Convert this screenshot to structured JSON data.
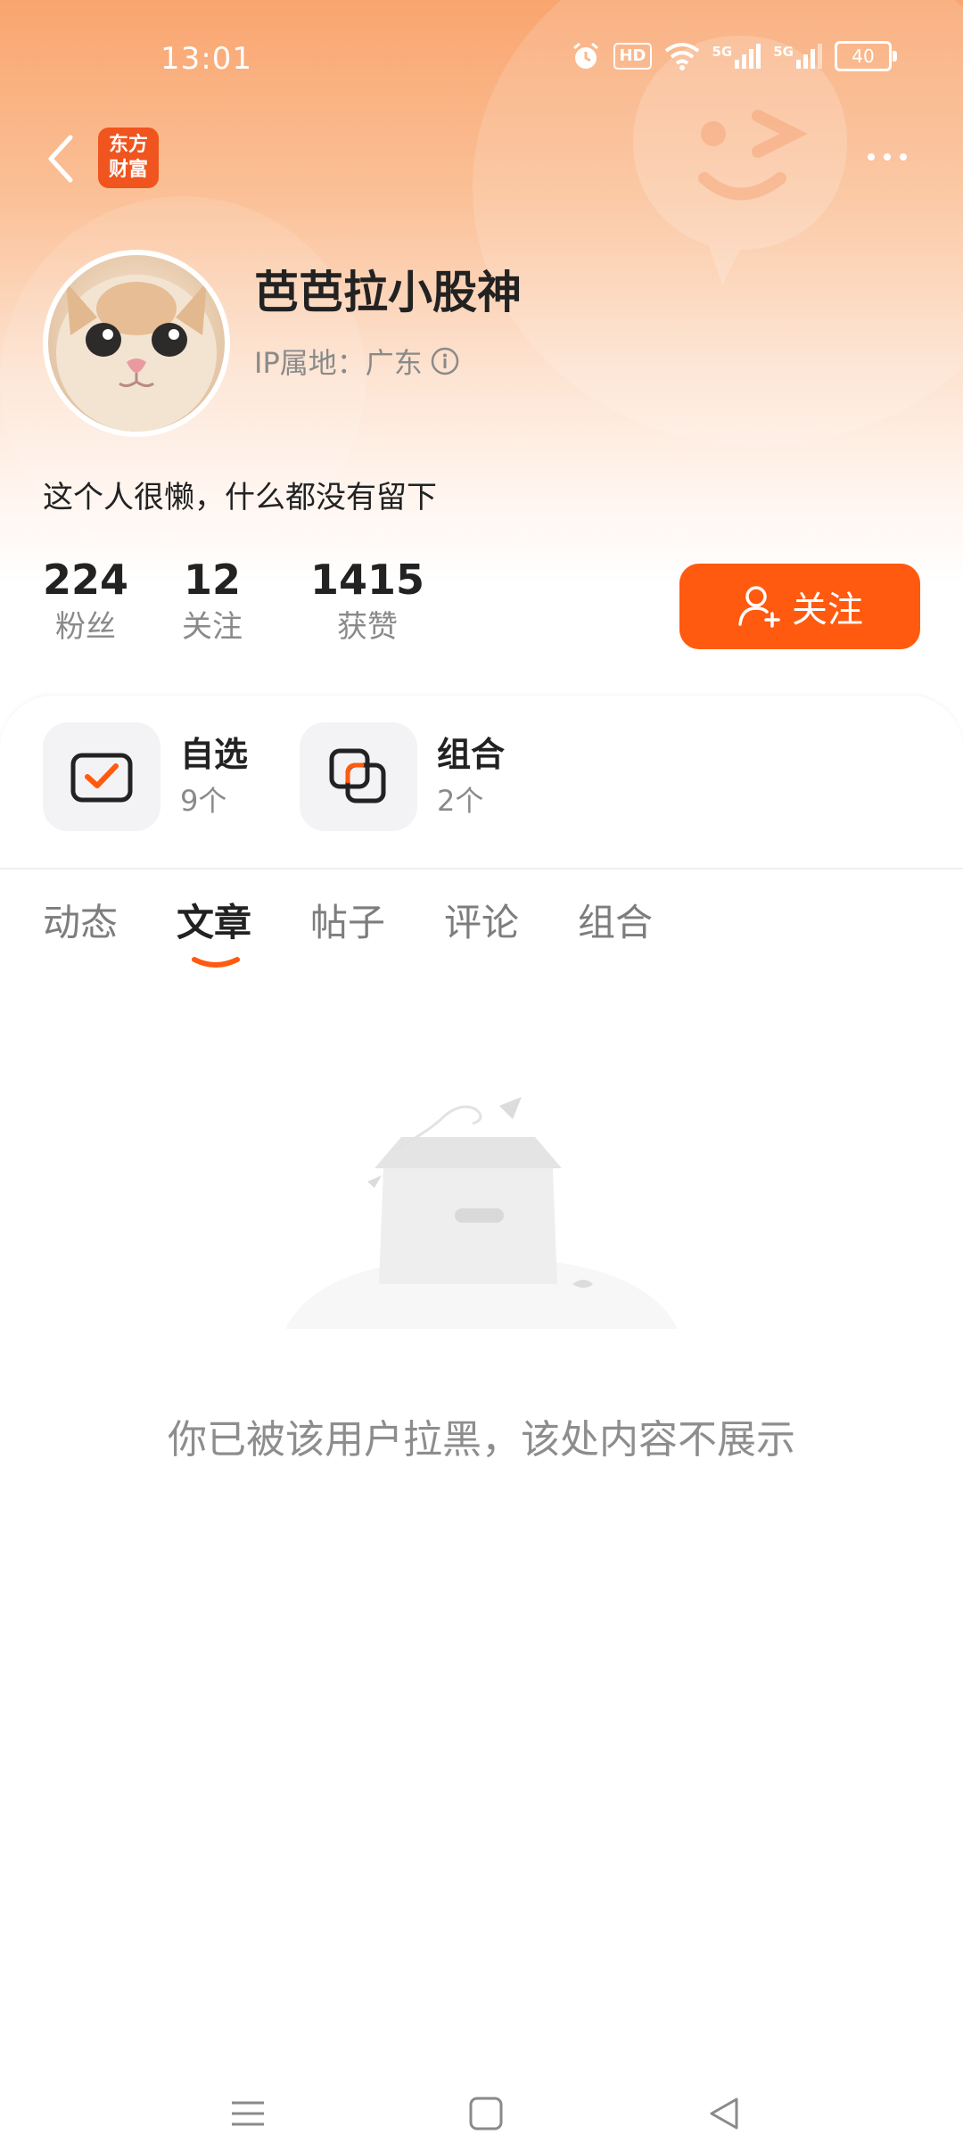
{
  "status_bar": {
    "time": "13:01",
    "hd_label": "HD",
    "network_1": "5G",
    "network_2": "5G",
    "battery": "40"
  },
  "nav": {
    "back_icon": "chevron-left-icon",
    "app_logo_line1": "东方",
    "app_logo_line2": "财富",
    "more_icon": "more-dots-icon"
  },
  "profile": {
    "username": "芭芭拉小股神",
    "ip_location": "IP属地：广东",
    "bio": "这个人很懒，什么都没有留下"
  },
  "stats": [
    {
      "value": "224",
      "label": "粉丝"
    },
    {
      "value": "12",
      "label": "关注"
    },
    {
      "value": "1415",
      "label": "获赞"
    }
  ],
  "follow_button": {
    "label": "关注",
    "color": "#ff5a0f"
  },
  "shortcuts": [
    {
      "title": "自选",
      "count": "9个",
      "icon": "watchlist-check-icon"
    },
    {
      "title": "组合",
      "count": "2个",
      "icon": "portfolio-squares-icon"
    }
  ],
  "tabs": [
    {
      "label": "动态",
      "active": false
    },
    {
      "label": "文章",
      "active": true
    },
    {
      "label": "帖子",
      "active": false
    },
    {
      "label": "评论",
      "active": false
    },
    {
      "label": "组合",
      "active": false
    }
  ],
  "empty_state": {
    "message": "你已被该用户拉黑，该处内容不展示",
    "icon": "empty-box-icon"
  },
  "colors": {
    "accent": "#ff5a0f",
    "header_gradient_top": "#f9a56f"
  }
}
